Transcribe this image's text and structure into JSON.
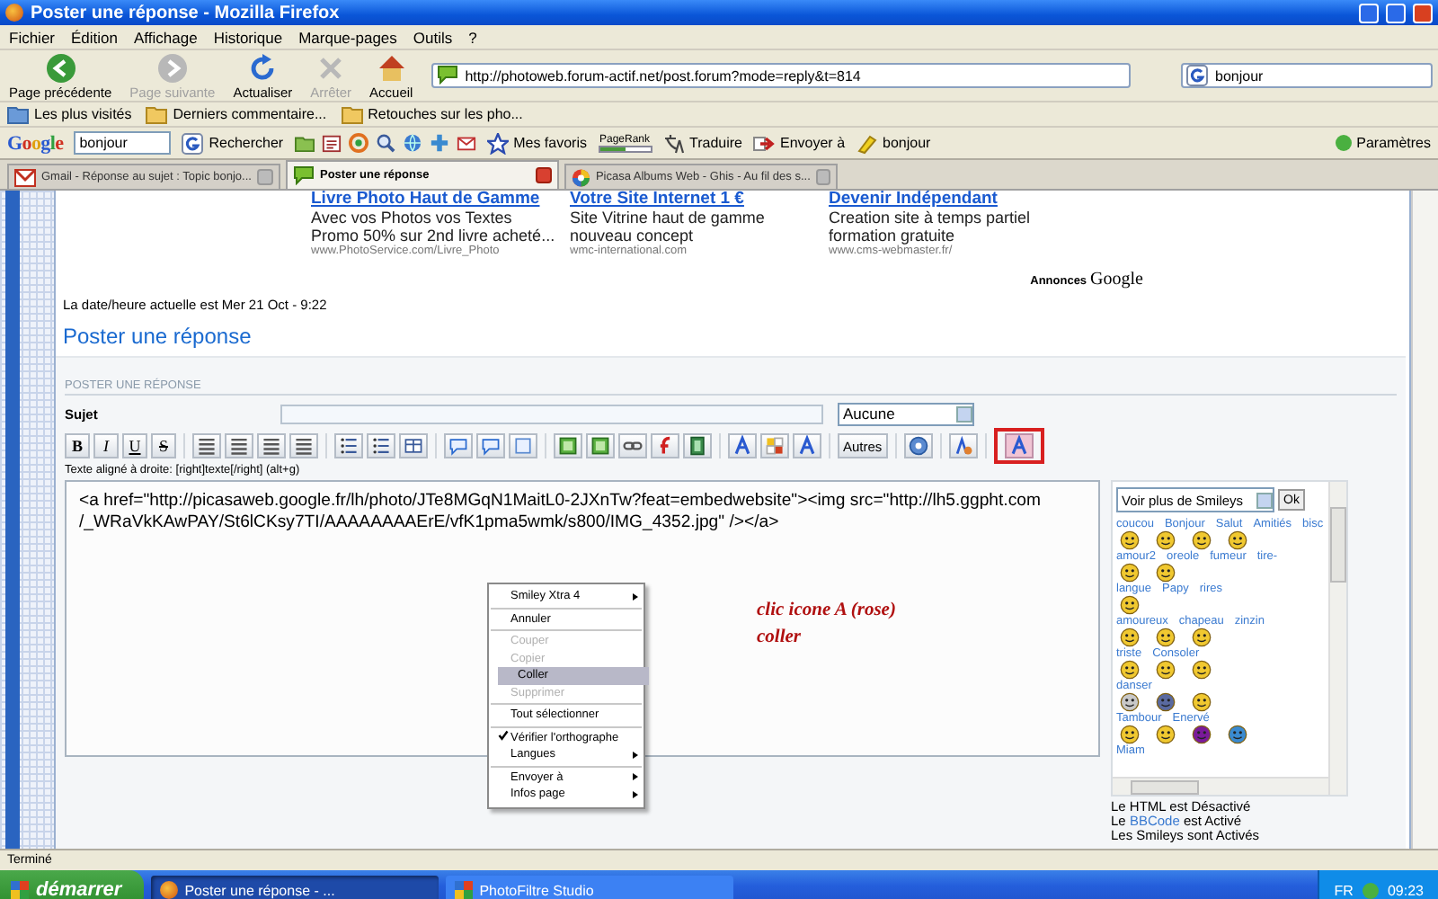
{
  "window": {
    "title": "Poster une réponse - Mozilla Firefox"
  },
  "menu": [
    "Fichier",
    "Édition",
    "Affichage",
    "Historique",
    "Marque-pages",
    "Outils",
    "?"
  ],
  "nav_buttons": [
    {
      "kind": "back",
      "label": "Page précédente",
      "disabled": false
    },
    {
      "kind": "forward",
      "label": "Page suivante",
      "disabled": true
    },
    {
      "kind": "reload",
      "label": "Actualiser",
      "disabled": false
    },
    {
      "kind": "stop",
      "label": "Arrêter",
      "disabled": true
    },
    {
      "kind": "home",
      "label": "Accueil",
      "disabled": false
    }
  ],
  "address": {
    "value": "http://photoweb.forum-actif.net/post.forum?mode=reply&t=814"
  },
  "search": {
    "value": "bonjour"
  },
  "bookmarks": [
    {
      "kind": "smart",
      "label": "Les plus visités"
    },
    {
      "kind": "folder",
      "label": "Derniers commentaire..."
    },
    {
      "kind": "folder",
      "label": "Retouches sur les pho..."
    }
  ],
  "google_toolbar": {
    "logo": "Google",
    "query": "bonjour",
    "buttons": [
      {
        "kind": "search",
        "label": "Rechercher"
      },
      {
        "kind": "star",
        "label": "Mes favoris"
      },
      {
        "kind": "pagerank",
        "label": "PageRank"
      },
      {
        "kind": "translate",
        "label": "Traduire"
      },
      {
        "kind": "send",
        "label": "Envoyer à"
      },
      {
        "kind": "highlight",
        "label": "bonjour"
      }
    ],
    "settings": "Paramètres"
  },
  "tabs": [
    {
      "kind": "mail",
      "title": "Gmail - Réponse au sujet : Topic bonjo...",
      "selected": false
    },
    {
      "kind": "bubble",
      "title": "Poster une réponse",
      "selected": true
    },
    {
      "kind": "pinwheel",
      "title": "Picasa Albums Web - Ghis - Au fil des s...",
      "selected": false
    }
  ],
  "page": {
    "ads": [
      {
        "title": "Livre Photo Haut de Gamme",
        "text": "Avec vos Photos vos Textes Promo 50% sur 2nd livre acheté...",
        "url": "www.PhotoService.com/Livre_Photo"
      },
      {
        "title": "Votre Site Internet 1 €",
        "text": "Site Vitrine haut de gamme nouveau concept",
        "url": "wmc-international.com"
      },
      {
        "title": "Devenir Indépendant",
        "text": "Creation site à temps partiel formation gratuite",
        "url": "www.cms-webmaster.fr/"
      }
    ],
    "ads_label": "Annonces",
    "ads_logo": "Google",
    "date": "La date/heure actuelle est Mer 21 Oct - 9:22",
    "heading": "Poster une réponse"
  },
  "form": {
    "title": "POSTER UNE RÉPONSE",
    "subject_label": "Sujet",
    "icon_select": "Aucune",
    "toolbar": [
      [
        {
          "kind": "bold",
          "label": "B",
          "highlighted": false
        },
        {
          "kind": "italic",
          "label": "I",
          "highlighted": false
        },
        {
          "kind": "underline",
          "label": "U",
          "highlighted": false
        },
        {
          "kind": "strike",
          "label": "S",
          "highlighted": false
        }
      ],
      [
        {
          "kind": "align",
          "highlighted": false
        },
        {
          "kind": "align",
          "highlighted": false
        },
        {
          "kind": "align",
          "highlighted": false
        },
        {
          "kind": "align",
          "highlighted": false
        }
      ],
      [
        {
          "kind": "list",
          "highlighted": false
        },
        {
          "kind": "list",
          "highlighted": false
        },
        {
          "kind": "table",
          "highlighted": false
        }
      ],
      [
        {
          "kind": "speech",
          "highlighted": false
        },
        {
          "kind": "speech",
          "highlighted": false
        },
        {
          "kind": "box",
          "highlighted": false
        }
      ],
      [
        {
          "kind": "image",
          "highlighted": false
        },
        {
          "kind": "image",
          "highlighted": false
        },
        {
          "kind": "link",
          "highlighted": false
        },
        {
          "kind": "flash",
          "highlighted": false
        },
        {
          "kind": "film",
          "highlighted": false
        }
      ],
      [
        {
          "kind": "font",
          "highlighted": false
        },
        {
          "kind": "grid",
          "highlighted": false
        },
        {
          "kind": "font",
          "highlighted": false
        }
      ],
      [
        {
          "kind": "text",
          "label": "Autres",
          "highlighted": false
        }
      ],
      [
        {
          "kind": "help",
          "highlighted": false
        }
      ],
      [
        {
          "kind": "pen",
          "highlighted": false
        }
      ],
      [
        {
          "kind": "font",
          "highlighted": true
        }
      ]
    ],
    "hint": "Texte aligné à droite: [right]texte[/right] (alt+g)",
    "message": "<a href=\"http://picasaweb.google.fr/lh/photo/JTe8MGqN1MaitL0-2JXnTw?feat=embedwebsite\"><img src=\"http://lh5.ggpht.com /_WRaVkKAwPAY/St6lCKsy7TI/AAAAAAAAErE/vfK1pma5wmk/s800/IMG_4352.jpg\" /></a>",
    "context_menu": [
      [
        {
          "label": "Smiley Xtra 4",
          "submenu": true,
          "disabled": false,
          "selected": false,
          "checked": false
        }
      ],
      [
        {
          "label": "Annuler",
          "submenu": false,
          "disabled": false,
          "selected": false,
          "checked": false
        }
      ],
      [
        {
          "label": "Couper",
          "submenu": false,
          "disabled": true,
          "selected": false,
          "checked": false
        },
        {
          "label": "Copier",
          "submenu": false,
          "disabled": true,
          "selected": false,
          "checked": false
        },
        {
          "label": "Coller",
          "submenu": false,
          "disabled": false,
          "selected": true,
          "checked": false
        },
        {
          "label": "Supprimer",
          "submenu": false,
          "disabled": true,
          "selected": false,
          "checked": false
        }
      ],
      [
        {
          "label": "Tout sélectionner",
          "submenu": false,
          "disabled": false,
          "selected": false,
          "checked": false
        }
      ],
      [
        {
          "label": "Vérifier l'orthographe",
          "submenu": false,
          "disabled": false,
          "selected": false,
          "checked": true
        },
        {
          "label": "Langues",
          "submenu": true,
          "disabled": false,
          "selected": false,
          "checked": false
        }
      ],
      [
        {
          "label": "Envoyer à",
          "submenu": true,
          "disabled": false,
          "selected": false,
          "checked": false
        },
        {
          "label": "Infos page",
          "submenu": true,
          "disabled": false,
          "selected": false,
          "checked": false
        }
      ]
    ],
    "annotation": [
      "clic icone A (rose)",
      "coller"
    ],
    "smileys": {
      "select": "Voir plus de Smileys",
      "ok": "Ok",
      "rows": [
        {
          "labels": [
            "coucou",
            "Bonjour",
            "Salut",
            "Amitiés",
            "bisc"
          ],
          "faces": [
            {
              "color": "#f0c830"
            },
            {
              "color": "#f0c830"
            },
            {
              "color": "#f0c830"
            },
            {
              "color": "#f0c830"
            }
          ]
        },
        {
          "labels": [
            "amour2",
            "oreole",
            "fumeur",
            "tire-"
          ],
          "faces": [
            {
              "color": "#f0c830"
            },
            {
              "color": "#f0c830"
            }
          ]
        },
        {
          "labels": [
            "langue",
            "Papy",
            "rires"
          ],
          "faces": [
            {
              "color": "#f0c830"
            }
          ]
        },
        {
          "labels": [
            "amoureux",
            "chapeau",
            "zinzin"
          ],
          "faces": [
            {
              "color": "#f0c830"
            },
            {
              "color": "#f0c830"
            },
            {
              "color": "#f0c830"
            }
          ]
        },
        {
          "labels": [
            "triste",
            "Consoler"
          ],
          "faces": [
            {
              "color": "#f0c830"
            },
            {
              "color": "#f0c830"
            },
            {
              "color": "#f0c830"
            }
          ]
        },
        {
          "labels": [
            "danser"
          ],
          "faces": [
            {
              "color": "#c8c8c8"
            },
            {
              "color": "#5a6aa0"
            },
            {
              "color": "#f0c830"
            }
          ]
        },
        {
          "labels": [
            "Tambour",
            "Enervé"
          ],
          "faces": [
            {
              "color": "#f0c830"
            },
            {
              "color": "#f0c830"
            },
            {
              "color": "#7a1a9a"
            },
            {
              "color": "#3a8ad0"
            }
          ]
        },
        {
          "labels": [
            "Miam"
          ],
          "faces": []
        }
      ]
    },
    "notes": [
      {
        "text": "Le HTML est Désactivé"
      },
      {
        "text": "Le ",
        "link": "BBCode",
        "after": " est Activé"
      },
      {
        "text": "Les Smileys sont Activés"
      }
    ]
  },
  "status": "Terminé",
  "taskbar": {
    "start": "démarrer",
    "tasks": [
      {
        "kind": "browser",
        "label": "Poster une réponse - ...",
        "selected": true
      },
      {
        "kind": "photo",
        "label": "PhotoFiltre Studio",
        "selected": false
      }
    ],
    "lang": "FR",
    "clock": "09:23"
  }
}
